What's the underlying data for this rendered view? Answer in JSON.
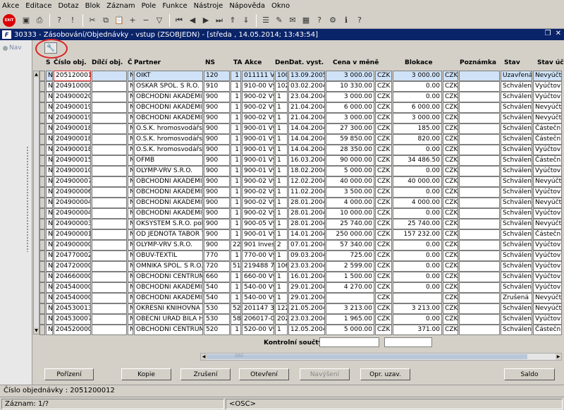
{
  "menu": [
    "Akce",
    "Editace",
    "Dotaz",
    "Blok",
    "Záznam",
    "Pole",
    "Funkce",
    "Nástroje",
    "Nápověda",
    "Okno"
  ],
  "toolbar": {
    "exit_label": "EXIT",
    "icons": [
      "save-icon",
      "print-icon",
      "query-enter-icon",
      "query-execute-icon",
      "cut-icon",
      "copy-icon",
      "paste-icon",
      "record-insert-icon",
      "record-delete-icon",
      "filter-icon",
      "first-record-icon",
      "prev-record-icon",
      "next-record-icon",
      "last-record-icon",
      "scroll-up-icon",
      "scroll-down-icon",
      "list-icon",
      "edit-icon",
      "mail-icon",
      "calendar-icon",
      "help-icon",
      "tools-icon",
      "info-icon",
      "question-icon"
    ]
  },
  "window": {
    "icon_label": "F",
    "title": "30333 - Zásobování/Objednávky - vstup (ZSOBJEDN) - [středa , 14.05.2014; 13:43:54]",
    "nav_label": "Nav"
  },
  "columns": [
    "S",
    "Číslo obj.",
    "Dílčí obj.",
    "Č",
    "Partner",
    "NS",
    "TA",
    "Akce",
    "Deni",
    "Dat. vyst.",
    "Cena v měně",
    "Blokace",
    "Poznámka",
    "Stav",
    "Stav účt"
  ],
  "rows": [
    {
      "s": "N",
      "cislo": "2051200012",
      "dilci": "",
      "c": "N",
      "partner": "OIKT",
      "ns": "120",
      "ta": "1",
      "akce": "011111 Výr",
      "den": "100",
      "dat": "13.09.2005",
      "cena": "3 000.00",
      "cur1": "CZK",
      "blok": "3 000.00",
      "cur2": "CZK",
      "pozn": "",
      "stav": "Uzavřená",
      "stavu": "Nevyúčt"
    },
    {
      "s": "N",
      "cislo": "2049100006",
      "dilci": "",
      "c": "N",
      "partner": "OSKAR SPOL. S R.O.",
      "ns": "910",
      "ta": "1",
      "akce": "910-00 Vý",
      "den": "102",
      "dat": "03.02.2004",
      "cena": "10 330.00",
      "cur1": "CZK",
      "blok": "0.00",
      "cur2": "CZK",
      "pozn": "",
      "stav": "Schválená",
      "stavu": "Vyúčtov"
    },
    {
      "s": "N",
      "cislo": "2049000207",
      "dilci": "",
      "c": "N",
      "partner": "OBCHODNI AKADEMIE M",
      "ns": "900",
      "ta": "1",
      "akce": "900-02 Vý",
      "den": "1",
      "dat": "23.04.2004",
      "cena": "3 000.00",
      "cur1": "CZK",
      "blok": "0.00",
      "cur2": "CZK",
      "pozn": "",
      "stav": "Schválená",
      "stavu": "Vyúčtov"
    },
    {
      "s": "N",
      "cislo": "2049000199",
      "dilci": "",
      "c": "N",
      "partner": "OBCHODNI AKADEMIE M",
      "ns": "900",
      "ta": "1",
      "akce": "900-02 Vý",
      "den": "1",
      "dat": "21.04.2004",
      "cena": "6 000.00",
      "cur1": "CZK",
      "blok": "6 000.00",
      "cur2": "CZK",
      "pozn": "",
      "stav": "Schválená",
      "stavu": "Nevyúčt"
    },
    {
      "s": "N",
      "cislo": "2049000198",
      "dilci": "",
      "c": "N",
      "partner": "OBCHODNI AKADEMIE M",
      "ns": "900",
      "ta": "1",
      "akce": "900-02 Vý",
      "den": "1",
      "dat": "21.04.2004",
      "cena": "3 000.00",
      "cur1": "CZK",
      "blok": "3 000.00",
      "cur2": "CZK",
      "pozn": "",
      "stav": "Schválená",
      "stavu": "Nevyúčt"
    },
    {
      "s": "N",
      "cislo": "2049000186",
      "dilci": "",
      "c": "N",
      "partner": "O.S.K. hromosvodářské",
      "ns": "900",
      "ta": "1",
      "akce": "900-01 Vý",
      "den": "1",
      "dat": "14.04.2004",
      "cena": "27 300.00",
      "cur1": "CZK",
      "blok": "185.00",
      "cur2": "CZK",
      "pozn": "",
      "stav": "Schválená",
      "stavu": "Částečn"
    },
    {
      "s": "N",
      "cislo": "2049000185",
      "dilci": "",
      "c": "N",
      "partner": "O.S.K. hromosvodářské",
      "ns": "900",
      "ta": "1",
      "akce": "900-01 Vý",
      "den": "1",
      "dat": "14.04.2004",
      "cena": "59 850.00",
      "cur1": "CZK",
      "blok": "820.00",
      "cur2": "CZK",
      "pozn": "",
      "stav": "Schválená",
      "stavu": "Částečn"
    },
    {
      "s": "N",
      "cislo": "2049000184",
      "dilci": "",
      "c": "N",
      "partner": "O.S.K. hromosvodářské",
      "ns": "900",
      "ta": "1",
      "akce": "900-01 Vý",
      "den": "1",
      "dat": "14.04.2004",
      "cena": "28 350.00",
      "cur1": "CZK",
      "blok": "0.00",
      "cur2": "CZK",
      "pozn": "",
      "stav": "Schválená",
      "stavu": "Vyúčtov"
    },
    {
      "s": "N",
      "cislo": "2049000152",
      "dilci": "",
      "c": "N",
      "partner": "OFMB",
      "ns": "900",
      "ta": "1",
      "akce": "900-01 Vý",
      "den": "1",
      "dat": "16.03.2004",
      "cena": "90 000.00",
      "cur1": "CZK",
      "blok": "34 486.50",
      "cur2": "CZK",
      "pozn": "",
      "stav": "Schválená",
      "stavu": "Částečn"
    },
    {
      "s": "N",
      "cislo": "2049000102",
      "dilci": "",
      "c": "N",
      "partner": "OLYMP-VRV S.R.O.",
      "ns": "900",
      "ta": "1",
      "akce": "900-01 Vý",
      "den": "1",
      "dat": "18.02.2004",
      "cena": "5 000.00",
      "cur1": "CZK",
      "blok": "0.00",
      "cur2": "CZK",
      "pozn": "",
      "stav": "Schválená",
      "stavu": "Vyúčtov"
    },
    {
      "s": "N",
      "cislo": "2049000075",
      "dilci": "",
      "c": "N",
      "partner": "OBCHODNI AKADEMIE M",
      "ns": "900",
      "ta": "1",
      "akce": "900-02 Vý",
      "den": "1",
      "dat": "12.02.2004",
      "cena": "40 000.00",
      "cur1": "CZK",
      "blok": "40 000.00",
      "cur2": "CZK",
      "pozn": "",
      "stav": "Schválená",
      "stavu": "Nevyúčt"
    },
    {
      "s": "N",
      "cislo": "2049000065",
      "dilci": "",
      "c": "N",
      "partner": "OBCHODNI AKADEMIE M",
      "ns": "900",
      "ta": "1",
      "akce": "900-02 Vý",
      "den": "1",
      "dat": "11.02.2004",
      "cena": "3 500.00",
      "cur1": "CZK",
      "blok": "0.00",
      "cur2": "CZK",
      "pozn": "",
      "stav": "Schválená",
      "stavu": "Vyúčtov"
    },
    {
      "s": "N",
      "cislo": "2049000043",
      "dilci": "",
      "c": "N",
      "partner": "OBCHODNI AKADEMIE M",
      "ns": "900",
      "ta": "1",
      "akce": "900-02 Vý",
      "den": "1",
      "dat": "28.01.2004",
      "cena": "4 000.00",
      "cur1": "CZK",
      "blok": "4 000.00",
      "cur2": "CZK",
      "pozn": "",
      "stav": "Schválená",
      "stavu": "Nevyúčt"
    },
    {
      "s": "N",
      "cislo": "2049000042",
      "dilci": "",
      "c": "N",
      "partner": "OBCHODNI AKADEMIE M",
      "ns": "900",
      "ta": "1",
      "akce": "900-02 Vý",
      "den": "1",
      "dat": "28.01.2004",
      "cena": "10 000.00",
      "cur1": "CZK",
      "blok": "0.00",
      "cur2": "CZK",
      "pozn": "",
      "stav": "Schválená",
      "stavu": "Vyúčtov"
    },
    {
      "s": "N",
      "cislo": "2049000039",
      "dilci": "",
      "c": "N",
      "partner": "OKSYSTEM S.R.O. pobo",
      "ns": "900",
      "ta": "1",
      "akce": "900-05 Vý",
      "den": "1",
      "dat": "28.01.2004",
      "cena": "25 740.00",
      "cur1": "CZK",
      "blok": "25 740.00",
      "cur2": "CZK",
      "pozn": "",
      "stav": "Schválená",
      "stavu": "Nevyúčt"
    },
    {
      "s": "N",
      "cislo": "2049000018",
      "dilci": "",
      "c": "N",
      "partner": "OD JEDNOTA TABOR TE",
      "ns": "900",
      "ta": "1",
      "akce": "900-01 Vý",
      "den": "1",
      "dat": "14.01.2004",
      "cena": "250 000.00",
      "cur1": "CZK",
      "blok": "157 232.00",
      "cur2": "CZK",
      "pozn": "",
      "stav": "Schválená",
      "stavu": "Částečn"
    },
    {
      "s": "N",
      "cislo": "2049000002",
      "dilci": "",
      "c": "N",
      "partner": "OLYMP-VRV S.R.O.",
      "ns": "900",
      "ta": "22",
      "akce": "901 Invest",
      "den": "2",
      "dat": "07.01.2004",
      "cena": "57 340.00",
      "cur1": "CZK",
      "blok": "0.00",
      "cur2": "CZK",
      "pozn": "",
      "stav": "Schválená",
      "stavu": "Vyúčtov"
    },
    {
      "s": "N",
      "cislo": "2047700026",
      "dilci": "",
      "c": "N",
      "partner": "OBUV-TEXTIL",
      "ns": "770",
      "ta": "1",
      "akce": "770-00 Vý",
      "den": "1",
      "dat": "09.03.2004",
      "cena": "725.00",
      "cur1": "CZK",
      "blok": "0.00",
      "cur2": "CZK",
      "pozn": "",
      "stav": "Schválená",
      "stavu": "Vyúčtov"
    },
    {
      "s": "N",
      "cislo": "2047200006",
      "dilci": "",
      "c": "N",
      "partner": "OMNIKA SPOL. S R.O. a",
      "ns": "720",
      "ta": "51",
      "akce": "219488 7",
      "den": "106",
      "dat": "23.03.2004",
      "cena": "2 599.00",
      "cur1": "CZK",
      "blok": "0.00",
      "cur2": "CZK",
      "pozn": "",
      "stav": "Schválená",
      "stavu": "Vyúčtov"
    },
    {
      "s": "N",
      "cislo": "2046600002",
      "dilci": "",
      "c": "N",
      "partner": "OBCHODNI CENTRUM V",
      "ns": "660",
      "ta": "1",
      "akce": "660-00 Vý",
      "den": "1",
      "dat": "16.01.2004",
      "cena": "1 500.00",
      "cur1": "CZK",
      "blok": "0.00",
      "cur2": "CZK",
      "pozn": "",
      "stav": "Schválená",
      "stavu": "Vyúčtov"
    },
    {
      "s": "N",
      "cislo": "2045400003",
      "dilci": "",
      "c": "N",
      "partner": "OBCHODNI AKADEMIE B",
      "ns": "540",
      "ta": "1",
      "akce": "540-00 Vý",
      "den": "1",
      "dat": "29.01.2004",
      "cena": "4 270.00",
      "cur1": "CZK",
      "blok": "0.00",
      "cur2": "CZK",
      "pozn": "",
      "stav": "Schválená",
      "stavu": "Vyúčtov"
    },
    {
      "s": "N",
      "cislo": "2045400002",
      "dilci": "",
      "c": "N",
      "partner": "OBCHODNI AKADEMIE P",
      "ns": "540",
      "ta": "1",
      "akce": "540-00 Vý",
      "den": "1",
      "dat": "29.01.2004",
      "cena": "",
      "cur1": "CZK",
      "blok": "",
      "cur2": "CZK",
      "pozn": "",
      "stav": "Zrušená",
      "stavu": "Nevyúčt"
    },
    {
      "s": "N",
      "cislo": "2045300139",
      "dilci": "",
      "c": "N",
      "partner": "OKRESNI KNIHOVNA DE",
      "ns": "530",
      "ta": "52",
      "akce": "201147 30",
      "den": "122",
      "dat": "21.05.2004",
      "cena": "3 213.00",
      "cur1": "CZK",
      "blok": "3 213.00",
      "cur2": "CZK",
      "pozn": "",
      "stav": "Schválená",
      "stavu": "Nevyúčt"
    },
    {
      "s": "N",
      "cislo": "2045300075",
      "dilci": "",
      "c": "N",
      "partner": "OBECNI URAD BILA HLI",
      "ns": "530",
      "ta": "58",
      "akce": "206017-01",
      "den": "202",
      "dat": "23.03.2004",
      "cena": "1 965.00",
      "cur1": "CZK",
      "blok": "0.00",
      "cur2": "CZK",
      "pozn": "",
      "stav": "Schválená",
      "stavu": "Vyúčtov"
    },
    {
      "s": "N",
      "cislo": "2045200009",
      "dilci": "",
      "c": "N",
      "partner": "OBCHODNI CENTRUM V",
      "ns": "520",
      "ta": "1",
      "akce": "520-00 Vý",
      "den": "1",
      "dat": "12.05.2004",
      "cena": "5 000.00",
      "cur1": "CZK",
      "blok": "371.00",
      "cur2": "CZK",
      "pozn": "",
      "stav": "Schválená",
      "stavu": "Částečn"
    }
  ],
  "footer": {
    "kontrol_label": "Kontrolní součty",
    "hscroll_label": "OSC"
  },
  "buttons": [
    "Pořízení",
    "Kopie",
    "Zrušení",
    "Otevření",
    "Navýšení",
    "Opr. uzav.",
    "Saldo"
  ],
  "status": {
    "field_info": "Číslo objednávky : 2051200012",
    "record": "Záznam: 1/?",
    "mode": "<OSC>"
  }
}
